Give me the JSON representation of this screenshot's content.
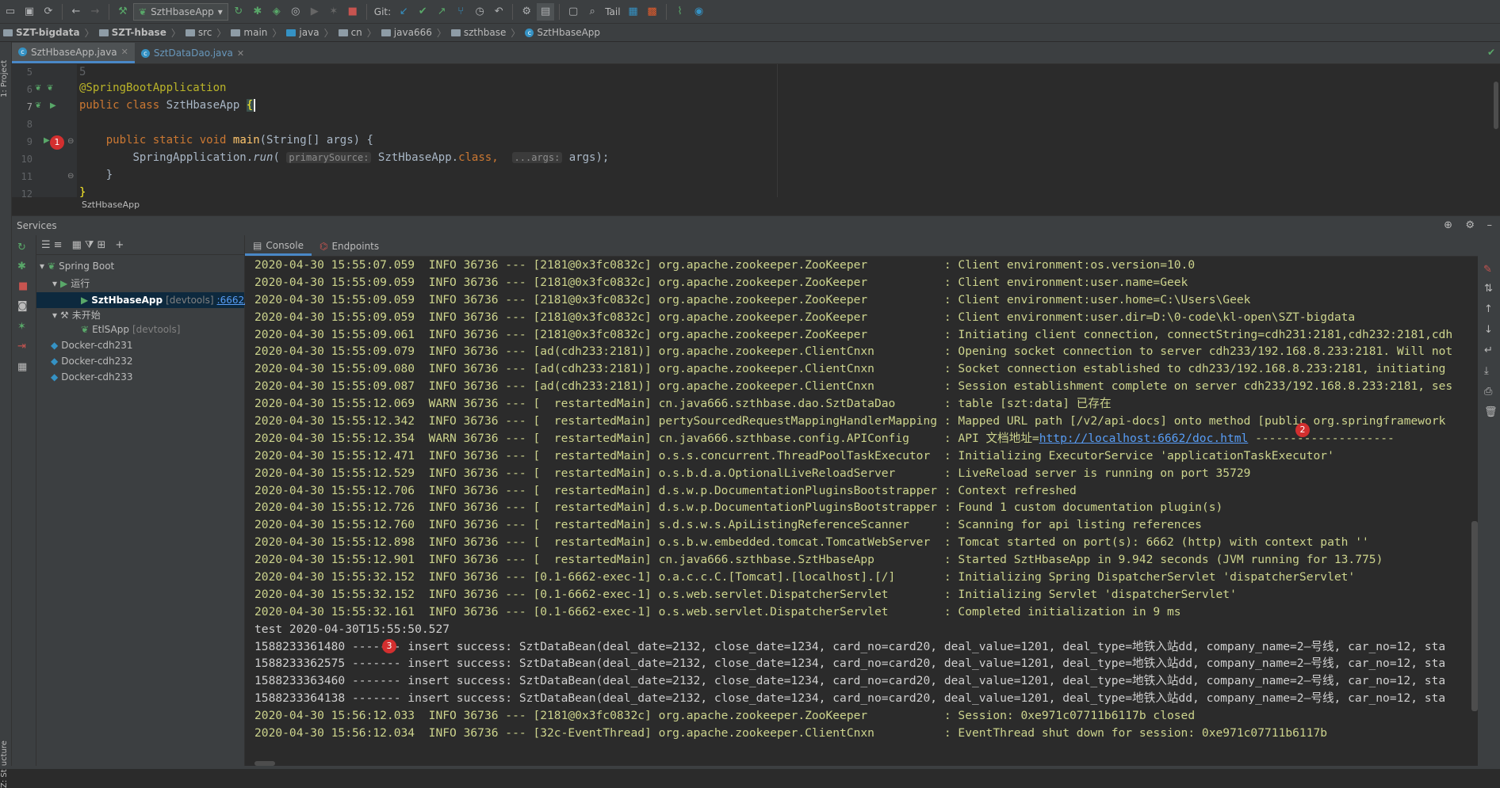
{
  "toolbar": {
    "run_config": "SztHbaseApp",
    "git_label": "Git:",
    "tail_label": "Tail"
  },
  "breadcrumb": [
    "SZT-bigdata",
    "SZT-hbase",
    "src",
    "main",
    "java",
    "cn",
    "java666",
    "szthbase",
    "SztHbaseApp"
  ],
  "side_tabs": {
    "project": "1: Project",
    "structure": "Z: Structure"
  },
  "editor": {
    "tabs": [
      {
        "label": "SztHbaseApp.java",
        "active": true
      },
      {
        "label": "SztDataDao.java",
        "active": false
      }
    ],
    "line_numbers": [
      "5",
      "6",
      "7",
      "8",
      "9",
      "10",
      "11",
      "12"
    ],
    "annotation": "@SpringBootApplication",
    "kw_public": "public",
    "kw_class": "class",
    "class_name": "SztHbaseApp",
    "brace_open": "{",
    "kw_static": "static",
    "kw_void": "void",
    "method_name": "main",
    "params": "(String[] args) {",
    "call_prefix": "SpringApplication.",
    "call_method": "run",
    "paren_open": "(",
    "hint_primary": "primarySource:",
    "arg_class": "SztHbaseApp.",
    "kw_class2": "class",
    "comma": ",",
    "hint_args": "...args:",
    "call_tail": "args);",
    "brace_close": "}",
    "footer_label": "SztHbaseApp"
  },
  "services": {
    "title": "Services",
    "tree": {
      "root": "Spring Boot",
      "running_group": "运行",
      "running_app": "SztHbaseApp",
      "running_tag": "[devtools]",
      "running_port": ":6662/",
      "not_started_group": "未开始",
      "stopped_app": "EtlSApp",
      "stopped_tag": "[devtools]",
      "docker": [
        "Docker-cdh231",
        "Docker-cdh232",
        "Docker-cdh233"
      ]
    },
    "console_tabs": {
      "console": "Console",
      "endpoints": "Endpoints"
    },
    "log_lines": [
      {
        "t": "2020-04-30 15:55:07.059  INFO 36736 --- [2181@0x3fc0832c] org.apache.zookeeper.ZooKeeper           : Client environment:os.version=10.0",
        "k": "lg"
      },
      {
        "t": "2020-04-30 15:55:09.059  INFO 36736 --- [2181@0x3fc0832c] org.apache.zookeeper.ZooKeeper           : Client environment:user.name=Geek",
        "k": "lg"
      },
      {
        "t": "2020-04-30 15:55:09.059  INFO 36736 --- [2181@0x3fc0832c] org.apache.zookeeper.ZooKeeper           : Client environment:user.home=C:\\Users\\Geek",
        "k": "lg"
      },
      {
        "t": "2020-04-30 15:55:09.059  INFO 36736 --- [2181@0x3fc0832c] org.apache.zookeeper.ZooKeeper           : Client environment:user.dir=D:\\0-code\\kl-open\\SZT-bigdata",
        "k": "lg"
      },
      {
        "t": "2020-04-30 15:55:09.061  INFO 36736 --- [2181@0x3fc0832c] org.apache.zookeeper.ZooKeeper           : Initiating client connection, connectString=cdh231:2181,cdh232:2181,cdh",
        "k": "lg"
      },
      {
        "t": "2020-04-30 15:55:09.079  INFO 36736 --- [ad(cdh233:2181)] org.apache.zookeeper.ClientCnxn          : Opening socket connection to server cdh233/192.168.8.233:2181. Will not",
        "k": "lg"
      },
      {
        "t": "2020-04-30 15:55:09.080  INFO 36736 --- [ad(cdh233:2181)] org.apache.zookeeper.ClientCnxn          : Socket connection established to cdh233/192.168.8.233:2181, initiating",
        "k": "lg"
      },
      {
        "t": "2020-04-30 15:55:09.087  INFO 36736 --- [ad(cdh233:2181)] org.apache.zookeeper.ClientCnxn          : Session establishment complete on server cdh233/192.168.8.233:2181, ses",
        "k": "lg"
      },
      {
        "t": "2020-04-30 15:55:12.069  WARN 36736 --- [  restartedMain] cn.java666.szthbase.dao.SztDataDao       : table [szt:data] 已存在",
        "k": "lw"
      },
      {
        "t": "2020-04-30 15:55:12.342  INFO 36736 --- [  restartedMain] pertySourcedRequestMappingHandlerMapping : Mapped URL path [/v2/api-docs] onto method [public org.springframework",
        "k": "lg"
      },
      {
        "t": "2020-04-30 15:55:12.354  WARN 36736 --- [  restartedMain] cn.java666.szthbase.config.APIConfig     : API 文档地址=",
        "k": "lw",
        "link": "http://localhost:6662/doc.html",
        "after": " --------------------"
      },
      {
        "t": "2020-04-30 15:55:12.471  INFO 36736 --- [  restartedMain] o.s.s.concurrent.ThreadPoolTaskExecutor  : Initializing ExecutorService 'applicationTaskExecutor'",
        "k": "lg"
      },
      {
        "t": "2020-04-30 15:55:12.529  INFO 36736 --- [  restartedMain] o.s.b.d.a.OptionalLiveReloadServer       : LiveReload server is running on port 35729",
        "k": "lg"
      },
      {
        "t": "2020-04-30 15:55:12.706  INFO 36736 --- [  restartedMain] d.s.w.p.DocumentationPluginsBootstrapper : Context refreshed",
        "k": "lg"
      },
      {
        "t": "2020-04-30 15:55:12.726  INFO 36736 --- [  restartedMain] d.s.w.p.DocumentationPluginsBootstrapper : Found 1 custom documentation plugin(s)",
        "k": "lg"
      },
      {
        "t": "2020-04-30 15:55:12.760  INFO 36736 --- [  restartedMain] s.d.s.w.s.ApiListingReferenceScanner     : Scanning for api listing references",
        "k": "lg"
      },
      {
        "t": "2020-04-30 15:55:12.898  INFO 36736 --- [  restartedMain] o.s.b.w.embedded.tomcat.TomcatWebServer  : Tomcat started on port(s): 6662 (http) with context path ''",
        "k": "lg"
      },
      {
        "t": "2020-04-30 15:55:12.901  INFO 36736 --- [  restartedMain] cn.java666.szthbase.SztHbaseApp          : Started SztHbaseApp in 9.942 seconds (JVM running for 13.775)",
        "k": "lg"
      },
      {
        "t": "2020-04-30 15:55:32.152  INFO 36736 --- [0.1-6662-exec-1] o.a.c.c.C.[Tomcat].[localhost].[/]       : Initializing Spring DispatcherServlet 'dispatcherServlet'",
        "k": "lg"
      },
      {
        "t": "2020-04-30 15:55:32.152  INFO 36736 --- [0.1-6662-exec-1] o.s.web.servlet.DispatcherServlet        : Initializing Servlet 'dispatcherServlet'",
        "k": "lg"
      },
      {
        "t": "2020-04-30 15:55:32.161  INFO 36736 --- [0.1-6662-exec-1] o.s.web.servlet.DispatcherServlet        : Completed initialization in 9 ms",
        "k": "lg"
      },
      {
        "t": "test 2020-04-30T15:55:50.527",
        "k": "lp"
      },
      {
        "t": "1588233361480 ------- insert success: SztDataBean(deal_date=2132, close_date=1234, card_no=card20, deal_value=1201, deal_type=地铁入站dd, company_name=2—号线, car_no=12, sta",
        "k": "lp"
      },
      {
        "t": "1588233362575 ------- insert success: SztDataBean(deal_date=2132, close_date=1234, card_no=card20, deal_value=1201, deal_type=地铁入站dd, company_name=2—号线, car_no=12, sta",
        "k": "lp"
      },
      {
        "t": "1588233363460 ------- insert success: SztDataBean(deal_date=2132, close_date=1234, card_no=card20, deal_value=1201, deal_type=地铁入站dd, company_name=2—号线, car_no=12, sta",
        "k": "lp"
      },
      {
        "t": "1588233364138 ------- insert success: SztDataBean(deal_date=2132, close_date=1234, card_no=card20, deal_value=1201, deal_type=地铁入站dd, company_name=2—号线, car_no=12, sta",
        "k": "lp"
      },
      {
        "t": "2020-04-30 15:56:12.033  INFO 36736 --- [2181@0x3fc0832c] org.apache.zookeeper.ZooKeeper           : Session: 0xe971c07711b6117b closed",
        "k": "lg"
      },
      {
        "t": "2020-04-30 15:56:12.034  INFO 36736 --- [32c-EventThread] org.apache.zookeeper.ClientCnxn          : EventThread shut down for session: 0xe971c07711b6117b",
        "k": "lg"
      }
    ]
  },
  "badges": [
    "1",
    "2",
    "3"
  ],
  "colors": {
    "accent": "#4a88c7",
    "badge": "#d32f2f",
    "log_text": "#cdd48d",
    "link": "#589df6"
  }
}
